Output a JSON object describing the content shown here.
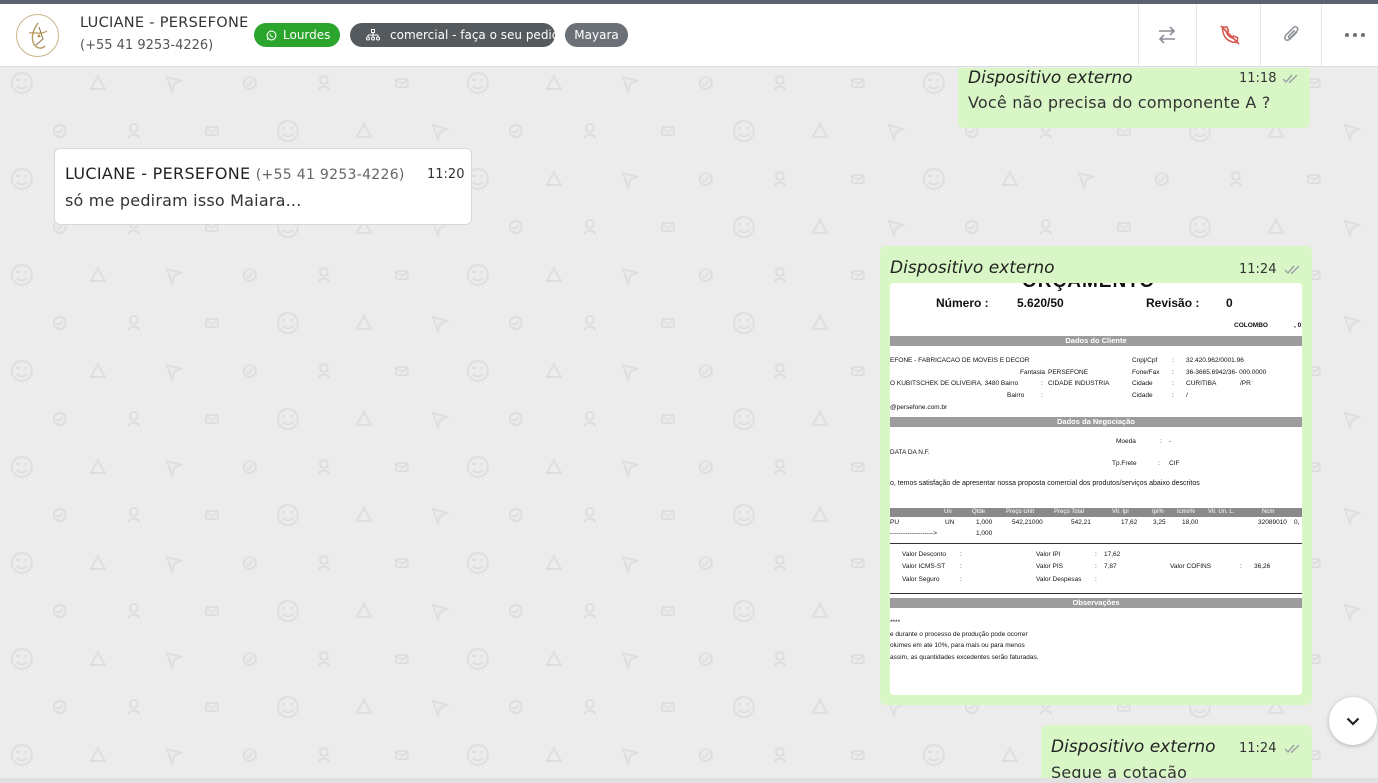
{
  "header": {
    "contact_name": "LUCIANE - PERSEFONE",
    "contact_phone": "(+55 41 9253-4226)",
    "tags": [
      {
        "label": "Lourdes",
        "color": "#2ca52c",
        "icon": "whatsapp-icon"
      },
      {
        "label": "comercial - faça o seu pedido",
        "color": "#555a5f",
        "icon": "sitemap-icon"
      },
      {
        "label": "Mayara",
        "color": "#6b7177"
      }
    ],
    "actions": [
      {
        "name": "transfer-icon"
      },
      {
        "name": "end-call-icon",
        "color": "#d9534f"
      },
      {
        "name": "paperclip-icon"
      },
      {
        "name": "more-options-icon"
      }
    ]
  },
  "messages": [
    {
      "direction": "out",
      "sender": "Dispositivo externo",
      "time": "11:18",
      "text": "Você não precisa do componente A ?"
    },
    {
      "direction": "in",
      "sender": "LUCIANE - PERSEFONE",
      "sender_phone": "(+55 41 9253-4226)",
      "time": "11:20",
      "text": "só me pediram isso Maiara..."
    },
    {
      "direction": "out",
      "sender": "Dispositivo externo",
      "time": "11:24",
      "attachment": "document-image"
    },
    {
      "direction": "out",
      "sender": "Dispositivo externo",
      "time": "11:24",
      "text": "Segue a cotação"
    }
  ],
  "document": {
    "title_partial": "ORÇAMENTO",
    "numero_label": "Número :",
    "numero_value": "5.620/50",
    "revisao_label": "Revisão :",
    "revisao_value": "0",
    "city": "COLOMBO",
    "city_suffix": ", 0",
    "section_cliente": "Dados do Cliente",
    "cliente_name": "EFONE - FABRICACAO DE MOVEIS E DECOR",
    "fantasia_label": "Fantasia",
    "fantasia_value": "PERSEFONE",
    "address": "O KUBITSCHEK DE OLIVEIRA, 3480 Bairro",
    "bairro_value": "CIDADE INDUSTRIA",
    "bairro_label": "Bairro",
    "email": "@persefone.com.br",
    "cnpj_label": "Cnpj/Cpf",
    "cnpj_value": "32.420.962/0001.96",
    "fone_label": "Fone/Fax",
    "fone_value": "36-3665.6942/36- 000.0000",
    "cidade_label": "Cidade",
    "cidade_value": "CURITIBA",
    "uf_value": "/PR",
    "cidade2_value": "/",
    "section_negociacao": "Dados da Negociação",
    "moeda_label": "Moeda",
    "moeda_value": "-",
    "data_nf": "DATA DA N.F.",
    "tpfrete_label": "Tp.Frete",
    "tpfrete_value": "CIF",
    "proposal_text": "o, temos satisfação de apresentar nossa proposta comercial dos produtos/serviços abaixo descritos",
    "columns": [
      "Un",
      "Qtde",
      "Preço Unit",
      "Preço Total",
      "Vlr. Ipi",
      "Ipi%",
      "Icms%",
      "Vlr. Un. L.",
      "Ncm"
    ],
    "row": [
      "PU",
      "UN",
      "1,000",
      "542,21000",
      "542,21",
      "17,62",
      "3,25",
      "18,00",
      "32089010",
      "0,"
    ],
    "subtotal_arrow": "-------------------->",
    "subtotal_qty": "1,000",
    "valor_desconto": "Valor Desconto",
    "valor_icms_st": "Valor ICMS-ST",
    "valor_seguro": "Valor Seguro",
    "valor_ipi": "Valor IPI",
    "valor_ipi_value": "17,62",
    "valor_pis": "Valor PIS",
    "valor_pis_value": "7,87",
    "valor_despesas": "Valor Despesas",
    "valor_cofins": "Valor COFINS",
    "valor_cofins_value": "36,26",
    "colon": ":",
    "section_observacoes": "Observações",
    "obs_stars": "****",
    "obs_line1": "e durante o processo de produção pode ocorrer",
    "obs_line2": "olumes em ate 10%, para mais ou para menos",
    "obs_line3": "assim, as quantidades excedentes serão faturadas."
  },
  "colors": {
    "outgoing_bubble": "#d9f7c6",
    "incoming_bubble": "#ffffff",
    "tick": "#9aa0a6"
  }
}
